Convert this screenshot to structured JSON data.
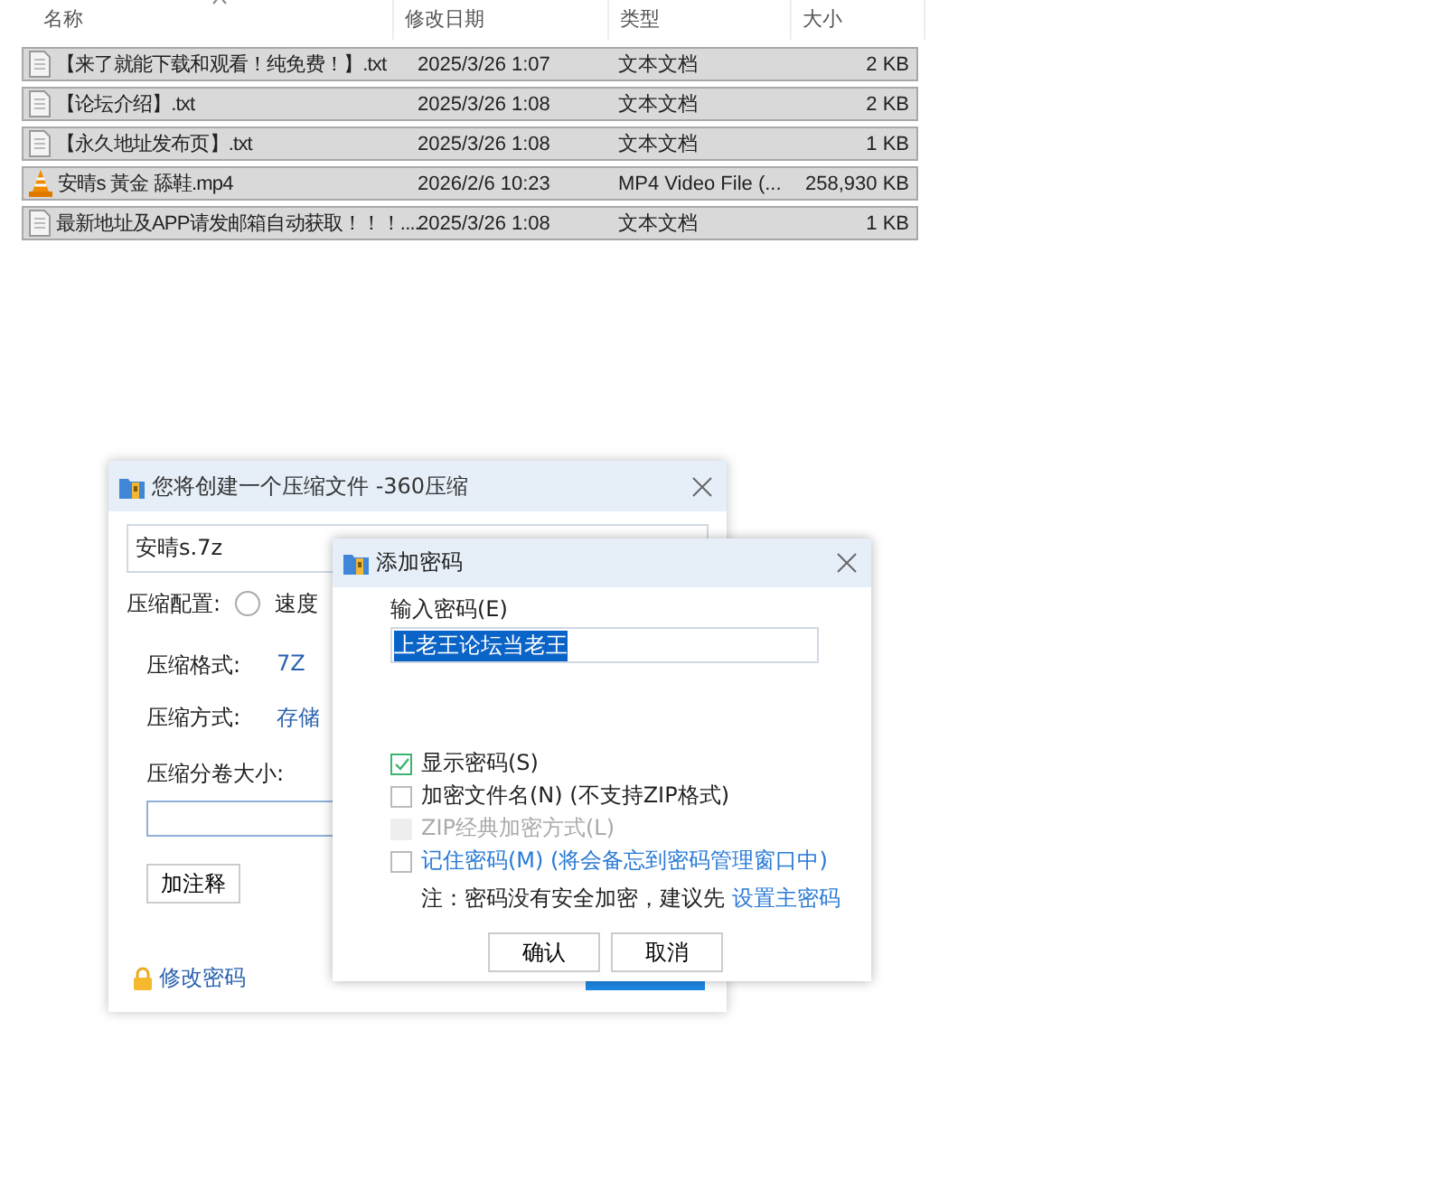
{
  "file_list": {
    "columns": [
      "名称",
      "修改日期",
      "类型",
      "大小"
    ],
    "rows": [
      {
        "kind": "text",
        "name": "【来了就能下载和观看！纯免费！】.txt",
        "date": "2025/3/26 1:07",
        "type": "文本文档",
        "size": "2 KB",
        "selected": true
      },
      {
        "kind": "text",
        "name": "【论坛介绍】.txt",
        "date": "2025/3/26 1:08",
        "type": "文本文档",
        "size": "2 KB",
        "selected": true
      },
      {
        "kind": "text",
        "name": "【永久地址发布页】.txt",
        "date": "2025/3/26 1:08",
        "type": "文本文档",
        "size": "1 KB",
        "selected": true
      },
      {
        "kind": "video",
        "name": "安晴s 黃金 舔鞋.mp4",
        "date": "2026/2/6 10:23",
        "type": "MP4 Video File (...",
        "size": "258,930 KB",
        "selected": true
      },
      {
        "kind": "text",
        "name": "最新地址及APP请发邮箱自动获取！！！....",
        "date": "2025/3/26 1:08",
        "type": "文本文档",
        "size": "1 KB",
        "selected": true
      }
    ]
  },
  "compress_dialog": {
    "title": "您将创建一个压缩文件 -360压缩",
    "filename": "安晴s.7z",
    "config_label": "压缩配置:",
    "config_option": "速度",
    "config_selected": false,
    "format_label": "压缩格式:",
    "format_value": "7Z",
    "method_label": "压缩方式:",
    "method_value": "存储",
    "split_label": "压缩分卷大小:",
    "comment_button": "加注释",
    "password_link": "修改密码"
  },
  "password_dialog": {
    "title": "添加密码",
    "input_label": "输入密码(E)",
    "password": "上老王论坛当老王",
    "options": [
      {
        "label": "显示密码(S)",
        "checked": true,
        "disabled": false,
        "link": false
      },
      {
        "label": "加密文件名(N) (不支持ZIP格式)",
        "checked": false,
        "disabled": false,
        "link": false
      },
      {
        "label": "ZIP经典加密方式(L)",
        "checked": false,
        "disabled": true,
        "link": false
      },
      {
        "label": "记住密码(M) (将会备忘到密码管理窗口中)",
        "checked": false,
        "disabled": false,
        "link": true
      }
    ],
    "note": "注：密码没有安全加密，建议先",
    "note_link": "设置主密码",
    "buttons": [
      "确认",
      "取消"
    ]
  }
}
